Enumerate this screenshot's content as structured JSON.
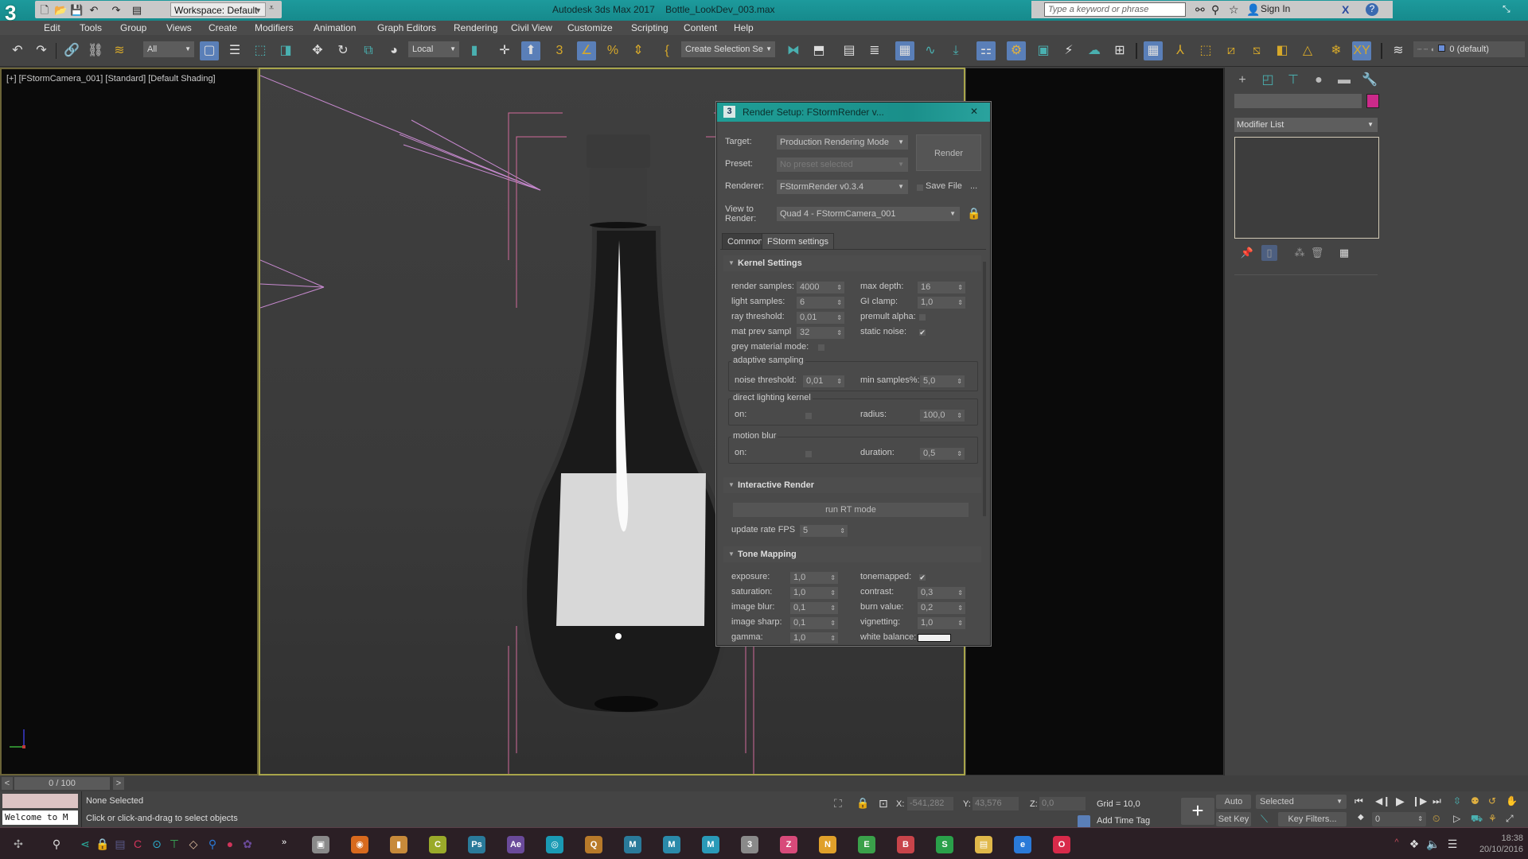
{
  "titlebar": {
    "app_title": "Autodesk 3ds Max 2017",
    "file_name": "Bottle_LookDev_003.max",
    "workspace": "Workspace: Default",
    "search_placeholder": "Type a keyword or phrase",
    "sign_in": "Sign In",
    "logo": "3"
  },
  "menu": [
    "Edit",
    "Tools",
    "Group",
    "Views",
    "Create",
    "Modifiers",
    "Animation",
    "Graph Editors",
    "Rendering",
    "Civil View",
    "Customize",
    "Scripting",
    "Content",
    "Help"
  ],
  "toolbar": {
    "selection_filter": "All",
    "ref_coord": "Local",
    "named_selection": "Create Selection Se",
    "layer": "0 (default)"
  },
  "viewport": {
    "label": "[+] [FStormCamera_001] [Standard] [Default Shading]"
  },
  "command_panel": {
    "modifier_list": "Modifier List",
    "color": "#cc2a8a"
  },
  "render_setup": {
    "title": "Render Setup: FStormRender v...",
    "target_label": "Target:",
    "target_value": "Production Rendering Mode",
    "preset_label": "Preset:",
    "preset_value": "No preset selected",
    "renderer_label": "Renderer:",
    "renderer_value": "FStormRender v0.3.4",
    "save_file_label": "Save File",
    "more": "...",
    "view_label_1": "View to",
    "view_label_2": "Render:",
    "view_value": "Quad 4 - FStormCamera_001",
    "render_button": "Render",
    "tabs": [
      "Common",
      "FStorm settings"
    ],
    "kernel": {
      "header": "Kernel Settings",
      "render_samples_label": "render samples:",
      "render_samples": "4000",
      "max_depth_label": "max depth:",
      "max_depth": "16",
      "light_samples_label": "light samples:",
      "light_samples": "6",
      "gi_clamp_label": "GI clamp:",
      "gi_clamp": "1,0",
      "ray_threshold_label": "ray threshold:",
      "ray_threshold": "0,01",
      "premult_alpha_label": "premult alpha:",
      "premult_alpha": false,
      "mat_prev_label": "mat prev sampl",
      "mat_prev": "32",
      "static_noise_label": "static noise:",
      "static_noise": true,
      "grey_material_label": "grey material mode:",
      "adaptive_title": "adaptive sampling",
      "noise_threshold_label": "noise threshold:",
      "noise_threshold": "0,01",
      "min_samples_label": "min samples%:",
      "min_samples": "5,0",
      "direct_title": "direct lighting kernel",
      "direct_on_label": "on:",
      "direct_on": false,
      "radius_label": "radius:",
      "radius": "100,0",
      "motion_title": "motion blur",
      "motion_on_label": "on:",
      "motion_on": false,
      "duration_label": "duration:",
      "duration": "0,5"
    },
    "interactive": {
      "header": "Interactive Render",
      "run_rt": "run RT mode",
      "fps_label": "update rate FPS",
      "fps": "5"
    },
    "tone": {
      "header": "Tone Mapping",
      "exposure_label": "exposure:",
      "exposure": "1,0",
      "tonemapped_label": "tonemapped:",
      "tonemapped": true,
      "saturation_label": "saturation:",
      "saturation": "1,0",
      "contrast_label": "contrast:",
      "contrast": "0,3",
      "image_blur_label": "image blur:",
      "image_blur": "0,1",
      "burn_label": "burn value:",
      "burn": "0,2",
      "image_sharp_label": "image sharp:",
      "image_sharp": "0,1",
      "vignetting_label": "vignetting:",
      "vignetting": "1,0",
      "gamma_label": "gamma:",
      "gamma": "1,0",
      "white_balance_label": "white balance:"
    }
  },
  "timeline": {
    "frame": "0 / 100",
    "prev": "<",
    "next": ">"
  },
  "status": {
    "maxscript": "Welcome to M",
    "selection": "None Selected",
    "prompt": "Click or click-and-drag to select objects",
    "x_label": "X:",
    "x": "-541,282",
    "y_label": "Y:",
    "y": "43,576",
    "z_label": "Z:",
    "z": "0,0",
    "grid": "Grid = 10,0",
    "add_time_tag": "Add Time Tag",
    "auto_key": "Auto Key",
    "set_key": "Set Key",
    "key_mode": "Selected",
    "key_filters": "Key Filters...",
    "current_frame": "0"
  },
  "taskbar": {
    "time": "18:38",
    "date": "20/10/2016",
    "apps": [
      {
        "name": "save",
        "glyph": "▣",
        "color": "#8a8a8a"
      },
      {
        "name": "chrome",
        "glyph": "◉",
        "color": "#d86a1e"
      },
      {
        "name": "notes",
        "glyph": "▮",
        "color": "#c78a3a"
      },
      {
        "name": "app-c",
        "glyph": "C",
        "color": "#9aaa2a"
      },
      {
        "name": "photoshop",
        "glyph": "Ps",
        "color": "#2a7a9a"
      },
      {
        "name": "after-effects",
        "glyph": "Ae",
        "color": "#6a4a9a"
      },
      {
        "name": "cinema",
        "glyph": "◎",
        "color": "#1a9ab4"
      },
      {
        "name": "quicktime",
        "glyph": "Q",
        "color": "#b87a2a"
      },
      {
        "name": "mudbox",
        "glyph": "M",
        "color": "#2a7a9a"
      },
      {
        "name": "maya",
        "glyph": "M",
        "color": "#2a8aaa"
      },
      {
        "name": "maya-2",
        "glyph": "M",
        "color": "#2a9ab8"
      },
      {
        "name": "3dsmax",
        "glyph": "3",
        "color": "#8a8a8a"
      },
      {
        "name": "zbrush",
        "glyph": "Z",
        "color": "#d84a7a"
      },
      {
        "name": "nuke",
        "glyph": "N",
        "color": "#e0a02a"
      },
      {
        "name": "evernote",
        "glyph": "E",
        "color": "#3aa04a"
      },
      {
        "name": "bookmark",
        "glyph": "B",
        "color": "#c8444a"
      },
      {
        "name": "spotify",
        "glyph": "S",
        "color": "#2aa04a"
      },
      {
        "name": "explorer",
        "glyph": "▤",
        "color": "#e0b84a"
      },
      {
        "name": "edge",
        "glyph": "e",
        "color": "#2a7ad8"
      },
      {
        "name": "opera",
        "glyph": "O",
        "color": "#d82a4a"
      }
    ]
  }
}
